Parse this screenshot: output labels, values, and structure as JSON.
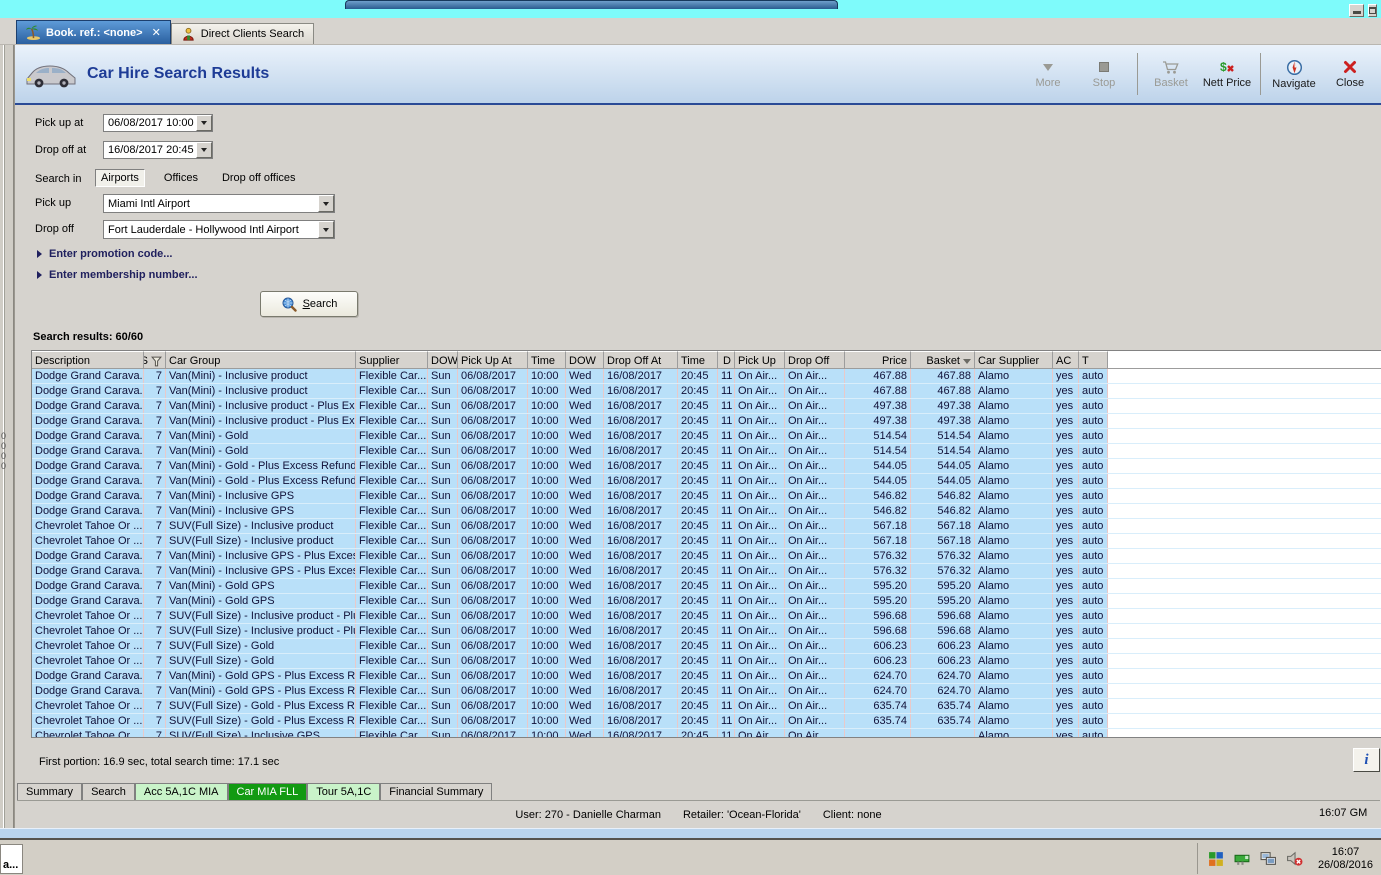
{
  "colors": {
    "row_blue": "#b9e0f9",
    "title_blue": "#1e3c96",
    "active_bottom_tab_green": "#129a12",
    "light_bottom_tab_green": "#c9f3c9",
    "desktop_cyan": "#7efbfb"
  },
  "tab_bar": {
    "tabs": [
      {
        "label": "Book. ref.: <none>",
        "icon": "palm-tree-icon",
        "active": true,
        "closable": true
      },
      {
        "label": "Direct Clients Search",
        "icon": "client-icon",
        "active": false,
        "closable": false
      }
    ],
    "window_buttons": [
      "minimize-icon",
      "restore-icon"
    ]
  },
  "header": {
    "title": "Car Hire Search Results",
    "title_icon": "car-icon",
    "toolbar": [
      {
        "label": "More",
        "icon": "down-triangle-icon",
        "disabled": true,
        "separator_after": false
      },
      {
        "label": "Stop",
        "icon": "stop-square-icon",
        "disabled": true,
        "separator_after": true
      },
      {
        "label": "Basket",
        "icon": "basket-icon",
        "disabled": true,
        "separator_after": false
      },
      {
        "label": "Nett Price",
        "icon": "nett-price-icon",
        "disabled": false,
        "separator_after": true
      },
      {
        "label": "Navigate",
        "icon": "compass-icon",
        "disabled": false,
        "separator_after": false
      },
      {
        "label": "Close",
        "icon": "close-x-icon",
        "disabled": false,
        "separator_after": false
      }
    ]
  },
  "search_form": {
    "pickup_at_label": "Pick up at",
    "pickup_at_value": "06/08/2017 10:00",
    "dropoff_at_label": "Drop off at",
    "dropoff_at_value": "16/08/2017 20:45",
    "search_in_label": "Search in",
    "search_in_options": [
      {
        "label": "Airports",
        "selected": true
      },
      {
        "label": "Offices",
        "selected": false
      },
      {
        "label": "Drop off offices",
        "selected": false
      }
    ],
    "pickup_label": "Pick up",
    "pickup_value": "Miami Intl Airport",
    "dropoff_label": "Drop off",
    "dropoff_value": "Fort Lauderdale - Hollywood Intl Airport",
    "promotion_expander": "Enter promotion code...",
    "membership_expander": "Enter membership number...",
    "search_button": "Search",
    "search_button_icon": "magnifier-globe-icon"
  },
  "results": {
    "summary": "Search results: 60/60",
    "columns": [
      "Description",
      "S",
      "Car Group",
      "Supplier",
      "DOW",
      "Pick Up At",
      "Time",
      "DOW",
      "Drop Off At",
      "Time",
      "D",
      "Pick Up",
      "Drop Off",
      "Price",
      "Basket",
      "Car Supplier",
      "AC",
      "T"
    ],
    "row_common": {
      "s": "7",
      "supplier": "Flexible Car...",
      "dow1": "Sun",
      "pickup_date": "06/08/2017",
      "pickup_time": "10:00",
      "dow2": "Wed",
      "dropoff_date": "16/08/2017",
      "dropoff_time": "20:45",
      "days": "11",
      "pickup_loc": "On Air...",
      "dropoff_loc": "On Air...",
      "car_supplier": "Alamo",
      "ac": "yes",
      "t": "auto"
    },
    "rows": [
      {
        "description": "Dodge Grand Carava...",
        "car_group": "Van(Mini) - Inclusive product",
        "price": "467.88",
        "basket": "467.88"
      },
      {
        "description": "Dodge Grand Carava...",
        "car_group": "Van(Mini) - Inclusive product",
        "price": "467.88",
        "basket": "467.88"
      },
      {
        "description": "Dodge Grand Carava...",
        "car_group": "Van(Mini) - Inclusive product - Plus Ex...",
        "price": "497.38",
        "basket": "497.38"
      },
      {
        "description": "Dodge Grand Carava...",
        "car_group": "Van(Mini) - Inclusive product - Plus Ex...",
        "price": "497.38",
        "basket": "497.38"
      },
      {
        "description": "Dodge Grand Carava...",
        "car_group": "Van(Mini) - Gold",
        "price": "514.54",
        "basket": "514.54"
      },
      {
        "description": "Dodge Grand Carava...",
        "car_group": "Van(Mini) - Gold",
        "price": "514.54",
        "basket": "514.54"
      },
      {
        "description": "Dodge Grand Carava...",
        "car_group": "Van(Mini) - Gold - Plus Excess Refund",
        "price": "544.05",
        "basket": "544.05"
      },
      {
        "description": "Dodge Grand Carava...",
        "car_group": "Van(Mini) - Gold - Plus Excess Refund",
        "price": "544.05",
        "basket": "544.05"
      },
      {
        "description": "Dodge Grand Carava...",
        "car_group": "Van(Mini) - Inclusive GPS",
        "price": "546.82",
        "basket": "546.82"
      },
      {
        "description": "Dodge Grand Carava...",
        "car_group": "Van(Mini) - Inclusive GPS",
        "price": "546.82",
        "basket": "546.82"
      },
      {
        "description": "Chevrolet Tahoe Or ...",
        "car_group": "SUV(Full Size) - Inclusive product",
        "price": "567.18",
        "basket": "567.18"
      },
      {
        "description": "Chevrolet Tahoe Or ...",
        "car_group": "SUV(Full Size) - Inclusive product",
        "price": "567.18",
        "basket": "567.18"
      },
      {
        "description": "Dodge Grand Carava...",
        "car_group": "Van(Mini) - Inclusive GPS - Plus Exces...",
        "price": "576.32",
        "basket": "576.32"
      },
      {
        "description": "Dodge Grand Carava...",
        "car_group": "Van(Mini) - Inclusive GPS - Plus Exces...",
        "price": "576.32",
        "basket": "576.32"
      },
      {
        "description": "Dodge Grand Carava...",
        "car_group": "Van(Mini) - Gold GPS",
        "price": "595.20",
        "basket": "595.20"
      },
      {
        "description": "Dodge Grand Carava...",
        "car_group": "Van(Mini) - Gold GPS",
        "price": "595.20",
        "basket": "595.20"
      },
      {
        "description": "Chevrolet Tahoe Or ...",
        "car_group": "SUV(Full Size) - Inclusive product - Plu...",
        "price": "596.68",
        "basket": "596.68"
      },
      {
        "description": "Chevrolet Tahoe Or ...",
        "car_group": "SUV(Full Size) - Inclusive product - Plu...",
        "price": "596.68",
        "basket": "596.68"
      },
      {
        "description": "Chevrolet Tahoe Or ...",
        "car_group": "SUV(Full Size) - Gold",
        "price": "606.23",
        "basket": "606.23"
      },
      {
        "description": "Chevrolet Tahoe Or ...",
        "car_group": "SUV(Full Size) - Gold",
        "price": "606.23",
        "basket": "606.23"
      },
      {
        "description": "Dodge Grand Carava...",
        "car_group": "Van(Mini) - Gold GPS - Plus Excess Ref...",
        "price": "624.70",
        "basket": "624.70"
      },
      {
        "description": "Dodge Grand Carava...",
        "car_group": "Van(Mini) - Gold GPS - Plus Excess Ref...",
        "price": "624.70",
        "basket": "624.70"
      },
      {
        "description": "Chevrolet Tahoe Or ...",
        "car_group": "SUV(Full Size) - Gold - Plus Excess Ref...",
        "price": "635.74",
        "basket": "635.74"
      },
      {
        "description": "Chevrolet Tahoe Or ...",
        "car_group": "SUV(Full Size) - Gold - Plus Excess Ref...",
        "price": "635.74",
        "basket": "635.74"
      }
    ],
    "partial_row": {
      "description": "Chevrolet Tahoe Or ...",
      "car_group": "SUV(Full Size) - Inclusive GPS",
      "price": "",
      "basket": ""
    },
    "timing": "First portion: 16.9 sec, total search time: 17.1 sec",
    "info_button": "i"
  },
  "bottom_tabs": [
    {
      "label": "Summary",
      "style": "plain"
    },
    {
      "label": "Search",
      "style": "plain"
    },
    {
      "label": "Acc 5A,1C MIA",
      "style": "green-light"
    },
    {
      "label": "Car MIA FLL",
      "style": "green-active"
    },
    {
      "label": "Tour 5A,1C",
      "style": "green-light"
    },
    {
      "label": "Financial Summary",
      "style": "plain"
    }
  ],
  "status_bar": {
    "user": "User: 270 - Danielle Charman",
    "retailer": "Retailer: 'Ocean-Florida'",
    "client": "Client: none",
    "right_text": "16:07 GM"
  },
  "background_window": {
    "fragments": [
      "0",
      "0",
      "0",
      "0"
    ]
  },
  "taskbar": {
    "left_button_label": "a...",
    "tray_icons": [
      "antivirus-icon",
      "network-card-icon",
      "network-computers-icon",
      "muted-speaker-icon"
    ],
    "clock_time": "16:07",
    "clock_date": "26/08/2016"
  }
}
